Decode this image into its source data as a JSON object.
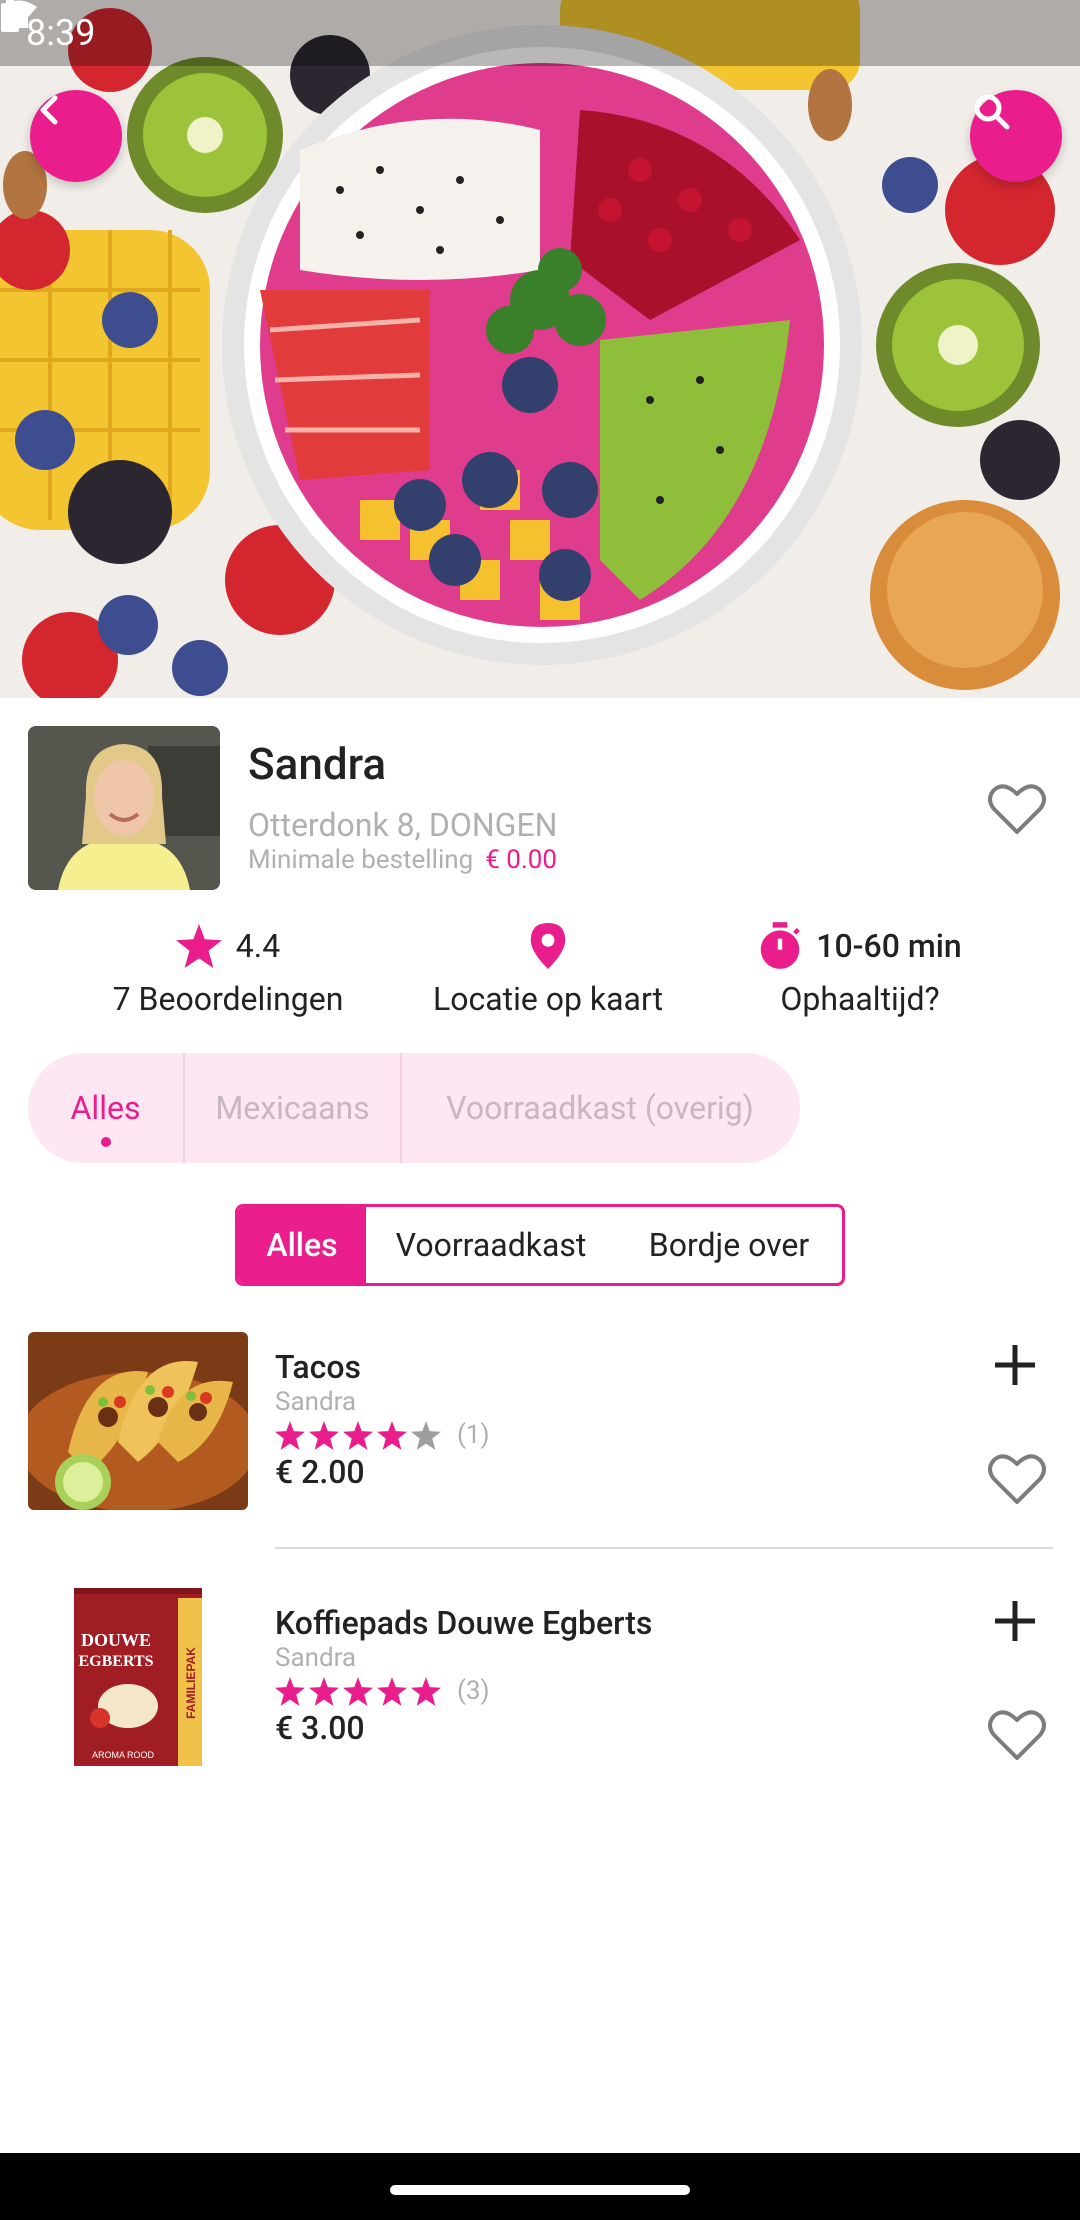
{
  "status_bar": {
    "time": "8:39"
  },
  "restaurant": {
    "name": "Sandra",
    "address": "Otterdonk 8, DONGEN",
    "min_order_label": "Minimale bestelling",
    "min_order_value": "€ 0.00"
  },
  "stats": {
    "rating": "4.4",
    "reviews": "7 Beoordelingen",
    "location": "Locatie op kaart",
    "pickup_time": "10-60 min",
    "pickup_label": "Ophaaltijd?"
  },
  "categories": [
    {
      "label": "Alles",
      "active": true
    },
    {
      "label": "Mexicaans",
      "active": false
    },
    {
      "label": "Voorraadkast (overig)",
      "active": false
    }
  ],
  "segments": [
    {
      "label": "Alles",
      "active": true
    },
    {
      "label": "Voorraadkast",
      "active": false
    },
    {
      "label": "Bordje over",
      "active": false
    }
  ],
  "products": [
    {
      "title": "Tacos",
      "seller": "Sandra",
      "rating": 4,
      "reviews": "(1)",
      "price": "€ 2.00"
    },
    {
      "title": "Koffiepads Douwe Egberts",
      "seller": "Sandra",
      "rating": 5,
      "reviews": "(3)",
      "price": "€ 3.00"
    }
  ],
  "coffee_pack": {
    "brand_line1": "DOUWE",
    "brand_line2": "EGBERTS",
    "side": "FAMILIEPAK",
    "bottom": "AROMA ROOD"
  },
  "colors": {
    "accent": "#e91e8c",
    "accent_light": "#fde7f2"
  },
  "icons": [
    "back-arrow-icon",
    "search-icon",
    "heart-outline-icon",
    "star-icon",
    "location-pin-icon",
    "stopwatch-icon",
    "plus-icon",
    "wifi-icon",
    "signal-icon",
    "battery-icon"
  ]
}
